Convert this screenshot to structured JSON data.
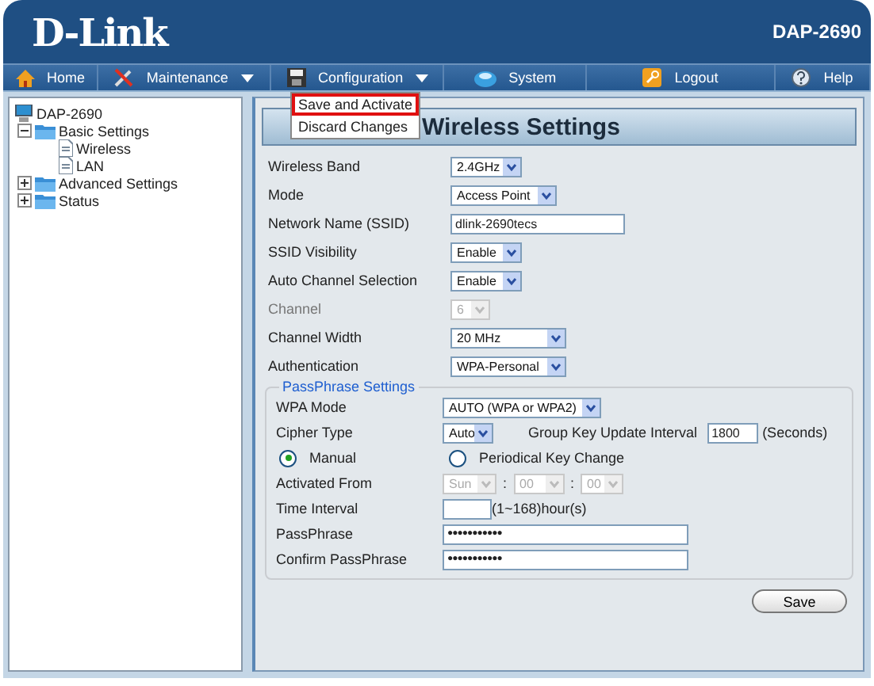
{
  "header": {
    "logo": "D-Link",
    "model": "DAP-2690"
  },
  "nav": [
    {
      "kind": "home",
      "label": "Home",
      "caret": false
    },
    {
      "kind": "tools",
      "label": "Maintenance",
      "caret": true
    },
    {
      "kind": "disk",
      "label": "Configuration",
      "caret": true
    },
    {
      "kind": "system",
      "label": "System",
      "caret": false
    },
    {
      "kind": "key",
      "label": "Logout",
      "caret": false
    },
    {
      "kind": "help",
      "label": "Help",
      "caret": false
    }
  ],
  "menu": [
    {
      "label": "Save and Activate",
      "selected": true
    },
    {
      "label": "Discard Changes",
      "selected": false
    }
  ],
  "tree": [
    {
      "kind": "device",
      "label": "DAP-2690",
      "children": [
        {
          "kind": "folder",
          "label": "Basic Settings",
          "expanded": true,
          "children": [
            {
              "kind": "page",
              "label": "Wireless"
            },
            {
              "kind": "page",
              "label": "LAN"
            }
          ]
        },
        {
          "kind": "folder",
          "label": "Advanced Settings",
          "expanded": false
        },
        {
          "kind": "folder",
          "label": "Status",
          "expanded": false
        }
      ]
    }
  ],
  "panel": {
    "title": "Wireless Settings",
    "rows": [
      {
        "label": "Wireless Band",
        "kind": "select",
        "value": "2.4GHz",
        "disabled": false
      },
      {
        "label": "Mode",
        "kind": "select",
        "value": "Access Point",
        "disabled": false
      },
      {
        "label": "Network Name (SSID)",
        "kind": "text",
        "value": "dlink-2690tecs"
      },
      {
        "label": "SSID Visibility",
        "kind": "select",
        "value": "Enable",
        "disabled": false
      },
      {
        "label": "Auto Channel Selection",
        "kind": "select",
        "value": "Enable",
        "disabled": false
      },
      {
        "label": "Channel",
        "kind": "select",
        "value": "6",
        "disabled": true
      },
      {
        "label": "Channel Width",
        "kind": "select",
        "value": "20 MHz",
        "disabled": false
      },
      {
        "label": "Authentication",
        "kind": "select",
        "value": "WPA-Personal",
        "disabled": false
      }
    ],
    "passphrase": {
      "legend": "PassPhrase Settings",
      "wpa_mode": {
        "label": "WPA Mode",
        "value": "AUTO (WPA or WPA2)"
      },
      "cipher": {
        "label": "Cipher Type",
        "value": "Auto",
        "group_label": "Group Key Update Interval",
        "group_value": "1800",
        "unit": "(Seconds)"
      },
      "radios": [
        {
          "label": "Manual",
          "selected": true
        },
        {
          "label": "Periodical Key Change",
          "selected": false
        }
      ],
      "activated_from": {
        "label": "Activated From",
        "day": "Sun",
        "sep1": ":",
        "hour": "00",
        "sep2": ":",
        "minute": "00",
        "disabled": true
      },
      "time_interval": {
        "label": "Time Interval",
        "hint": "(1~168)hour(s)"
      },
      "secrets": [
        {
          "label": "PassPhrase",
          "value": "●●●●●●●●●●●"
        },
        {
          "label": "Confirm PassPhrase",
          "value": "●●●●●●●●●●●"
        }
      ]
    },
    "save": "Save"
  }
}
